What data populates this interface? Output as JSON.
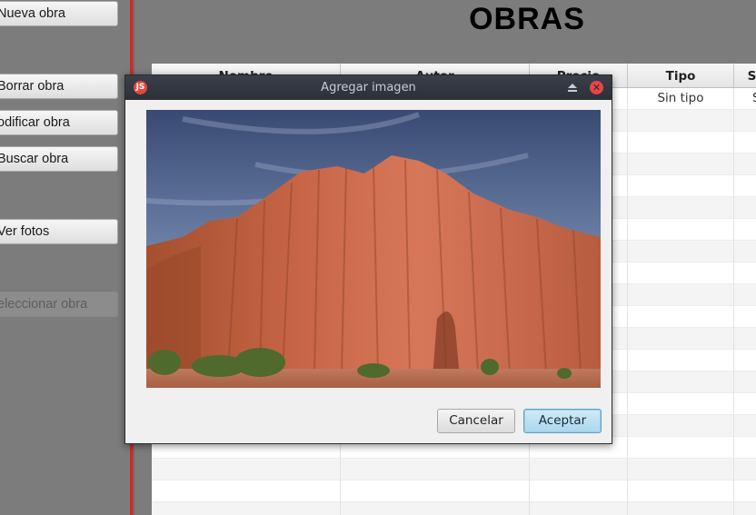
{
  "sidebar": {
    "buttons": [
      {
        "label": "Nueva obra"
      },
      {
        "label": "Borrar obra"
      },
      {
        "label": "odificar obra"
      },
      {
        "label": "Buscar obra"
      },
      {
        "label": " Ver fotos"
      },
      {
        "label": "eleccionar obra"
      }
    ]
  },
  "page": {
    "title": "OBRAS"
  },
  "table": {
    "headers": [
      "Nombre",
      "Autor",
      "Precio",
      "Tipo",
      "S"
    ],
    "first_row": {
      "tipo": "Sin tipo",
      "extra": "S"
    }
  },
  "dialog": {
    "title": "Agregar imagen",
    "cancel_label": "Cancelar",
    "accept_label": "Aceptar",
    "image_alt": "Red sandstone cliff under blue sky"
  },
  "colors": {
    "accent_red": "#e32020",
    "accept_button": "#a9d6ee",
    "titlebar": "#2c3038"
  },
  "icons": [
    "app-icon",
    "maximize-icon",
    "close-icon"
  ]
}
